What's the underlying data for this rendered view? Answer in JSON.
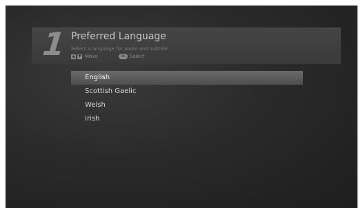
{
  "header": {
    "step": "1",
    "title": "Preferred Language",
    "subtitle": "Select a language for audio and subtitle.",
    "hints": {
      "up_key": "▲",
      "down_key": "▼",
      "move_label": "Move",
      "ok_key": "OK",
      "select_label": "Select"
    }
  },
  "languages": [
    {
      "label": "English",
      "selected": true
    },
    {
      "label": "Scottish Gaelic",
      "selected": false
    },
    {
      "label": "Welsh",
      "selected": false
    },
    {
      "label": "Irish",
      "selected": false
    }
  ],
  "selected_indicator": "›"
}
